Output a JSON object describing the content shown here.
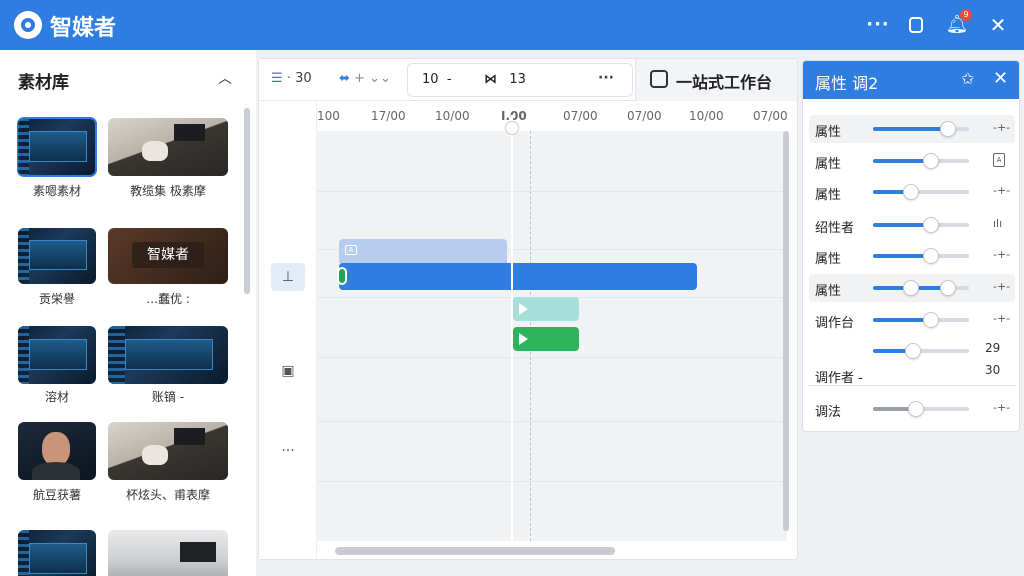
{
  "app": {
    "title": "智媒者"
  },
  "titlebar": {
    "more_icon": "more-horizontal-icon",
    "window_icon": "window-icon",
    "bell_icon": "bell-icon",
    "notification_count": "9",
    "close_icon": "close-icon"
  },
  "library": {
    "title": "素材库",
    "collapse_icon": "chevron-up-icon",
    "items": [
      {
        "label": "素嗯素材",
        "kind": "dark"
      },
      {
        "label": "教缆集  极素摩",
        "kind": "room"
      },
      {
        "label": "贡栄譽",
        "kind": "dark"
      },
      {
        "label": "",
        "kind": "warm",
        "watermark": "智媒者"
      },
      {
        "label": "溶材",
        "kind": "dark"
      },
      {
        "label": "…",
        "kind": "dark"
      },
      {
        "label": "…",
        "kind": "person"
      },
      {
        "label": "…",
        "kind": "room"
      },
      {
        "label": "",
        "kind": "dark"
      },
      {
        "label": "",
        "kind": "office"
      }
    ],
    "extra_labels": {
      "t4": "…蠢优 :",
      "t6": "账镝 -",
      "t7": "航豆获薯",
      "t8": "杯炫头、甫表摩"
    }
  },
  "timeline": {
    "toolbar": {
      "list_value": "30",
      "split_icon": "split-icon",
      "range_start": "10",
      "range_sep": "-",
      "range_end": "13",
      "more": "···",
      "workbench_label": "一站式工作台"
    },
    "ruler": [
      "100",
      "17/00",
      "10/00",
      "",
      "07/00",
      "07/00",
      "10/00",
      "07/00"
    ],
    "playhead_label": "I.00",
    "side_more": "···"
  },
  "props": {
    "title": "属性 调2",
    "pin_icon": "pin-icon",
    "close_icon": "close-icon",
    "rows": [
      {
        "label": "属性",
        "value": 0.78,
        "end": "-+-"
      },
      {
        "label": "属性",
        "value": 0.6,
        "end": "A"
      },
      {
        "label": "属性",
        "value": 0.4,
        "end": "-+-"
      },
      {
        "label": "绍性者",
        "value": 0.6,
        "end": "ılı"
      },
      {
        "label": "属性",
        "value": 0.6,
        "end": "-+-"
      },
      {
        "label": "属性",
        "value": 0.78,
        "end": "-+-"
      },
      {
        "label": "调作台",
        "value": 0.6,
        "end": "-+-"
      },
      {
        "label": "",
        "value": 0.42,
        "end": ""
      },
      {
        "label": "调作者 -",
        "value": null,
        "end": ""
      },
      {
        "label": "调法",
        "value": 0.45,
        "end": "-+-"
      }
    ],
    "values_a": "29",
    "values_b": "30"
  },
  "colors": {
    "accent": "#2f7de1",
    "green": "#2eb25e",
    "teal": "#a6dfd9"
  }
}
